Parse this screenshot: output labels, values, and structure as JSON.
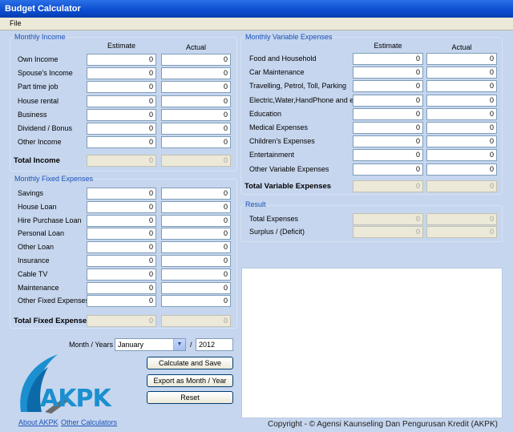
{
  "window": {
    "title": "Budget Calculator"
  },
  "menu": {
    "file": "File"
  },
  "columns": {
    "estimate": "Estimate",
    "actual": "Actual"
  },
  "income": {
    "title": "Monthly Income",
    "rows": [
      {
        "label": "Own Income",
        "estimate": "0",
        "actual": "0"
      },
      {
        "label": "Spouse's Income",
        "estimate": "0",
        "actual": "0"
      },
      {
        "label": "Part time job",
        "estimate": "0",
        "actual": "0"
      },
      {
        "label": "House rental",
        "estimate": "0",
        "actual": "0"
      },
      {
        "label": "Business",
        "estimate": "0",
        "actual": "0"
      },
      {
        "label": "Dividend / Bonus",
        "estimate": "0",
        "actual": "0"
      },
      {
        "label": "Other Income",
        "estimate": "0",
        "actual": "0"
      }
    ],
    "total_label": "Total Income",
    "total_estimate": "0",
    "total_actual": "0"
  },
  "fixed": {
    "title": "Monthly Fixed Expenses",
    "rows": [
      {
        "label": "Savings",
        "estimate": "0",
        "actual": "0"
      },
      {
        "label": "House Loan",
        "estimate": "0",
        "actual": "0"
      },
      {
        "label": "Hire Purchase Loan",
        "estimate": "0",
        "actual": "0"
      },
      {
        "label": "Personal Loan",
        "estimate": "0",
        "actual": "0"
      },
      {
        "label": "Other Loan",
        "estimate": "0",
        "actual": "0"
      },
      {
        "label": "Insurance",
        "estimate": "0",
        "actual": "0"
      },
      {
        "label": "Cable TV",
        "estimate": "0",
        "actual": "0"
      },
      {
        "label": "Maintenance",
        "estimate": "0",
        "actual": "0"
      },
      {
        "label": "Other Fixed Expenses",
        "estimate": "0",
        "actual": "0"
      }
    ],
    "total_label": "Total Fixed Expenses",
    "total_estimate": "0",
    "total_actual": "0"
  },
  "variable": {
    "title": "Monthly Variable Expenses",
    "rows": [
      {
        "label": "Food and Household",
        "estimate": "0",
        "actual": "0"
      },
      {
        "label": "Car Maintenance",
        "estimate": "0",
        "actual": "0"
      },
      {
        "label": "Travelling, Petrol, Toll, Parking",
        "estimate": "0",
        "actual": "0"
      },
      {
        "label": "Electric,Water,HandPhone and etc",
        "estimate": "0",
        "actual": "0"
      },
      {
        "label": "Education",
        "estimate": "0",
        "actual": "0"
      },
      {
        "label": "Medical Expenses",
        "estimate": "0",
        "actual": "0"
      },
      {
        "label": "Children's Expenses",
        "estimate": "0",
        "actual": "0"
      },
      {
        "label": "Entertainment",
        "estimate": "0",
        "actual": "0"
      },
      {
        "label": "Other Variable Expenses",
        "estimate": "0",
        "actual": "0"
      }
    ],
    "total_label": "Total Variable Expenses",
    "total_estimate": "0",
    "total_actual": "0"
  },
  "result": {
    "title": "Result",
    "total_expenses_label": "Total Expenses",
    "total_expenses_estimate": "0",
    "total_expenses_actual": "0",
    "surplus_label": "Surplus / (Deficit)",
    "surplus_estimate": "0",
    "surplus_actual": "0"
  },
  "period": {
    "label": "Month / Years",
    "month": "January",
    "separator": "/",
    "year": "2012"
  },
  "buttons": {
    "calculate": "Calculate and Save",
    "export": "Export as Month / Year",
    "reset": "Reset"
  },
  "logo": {
    "text": "AKPK",
    "color": "#1b8fd0"
  },
  "links": {
    "about": "About AKPK",
    "other": "Other Calculators"
  },
  "copyright": "Copyright - © Agensi Kaunseling Dan Pengurusan Kredit (AKPK)"
}
